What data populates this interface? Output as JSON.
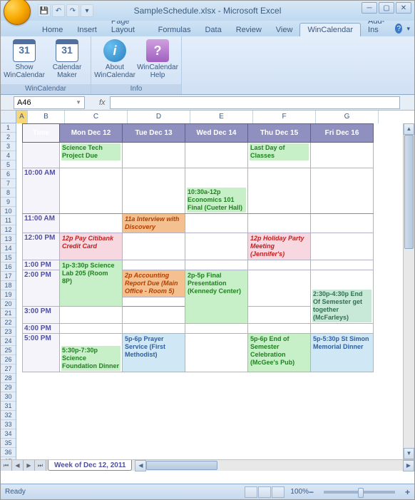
{
  "window": {
    "title": "SampleSchedule.xlsx - Microsoft Excel",
    "name_box": "A46",
    "status": "Ready",
    "zoom": "100%",
    "sheet_tab": "Week of Dec 12, 2011"
  },
  "tabs": {
    "home": "Home",
    "insert": "Insert",
    "page_layout": "Page Layout",
    "formulas": "Formulas",
    "data": "Data",
    "review": "Review",
    "view": "View",
    "wincalendar": "WinCalendar",
    "addins": "Add-Ins"
  },
  "ribbon": {
    "show": "Show\nWinCalendar",
    "maker": "Calendar\nMaker",
    "about": "About\nWinCalendar",
    "help": "WinCalendar\nHelp",
    "group1": "WinCalendar",
    "group2": "Info"
  },
  "cols": {
    "a": "A",
    "b": "B",
    "c": "C",
    "d": "D",
    "e": "E",
    "f": "F",
    "g": "G"
  },
  "headers": {
    "time": "Time",
    "mon": "Mon Dec 12",
    "tue": "Tue Dec 13",
    "wed": "Wed Dec 14",
    "thu": "Thu Dec 15",
    "fri": "Fri Dec 16"
  },
  "times": {
    "t10": "10:00 AM",
    "t11": "11:00 AM",
    "t12": "12:00 PM",
    "t1": "1:00 PM",
    "t2": "2:00 PM",
    "t3": "3:00 PM",
    "t4": "4:00 PM",
    "t5": "5:00 PM"
  },
  "events": {
    "sci_proj": "Science Tech Project Due",
    "last_day": "Last Day of Classes",
    "econ": "10:30a-12p Economics 101 Final (Cueter Hall)",
    "interview": "11a Interview with Discovery",
    "citibank": "12p Pay Citibank Credit Card",
    "holiday": "12p Holiday Party Meeting (Jennifer's)",
    "scilab": "1p-3:30p Science Lab 205 (Room 8P)",
    "accounting": "2p Accounting Report Due (Main Office - Room 5)",
    "kennedy": "2p-5p Final Presentation (Kennedy Center)",
    "mcfarleys": "2:30p-4:30p End Of Semester get together (McFarleys)",
    "prayer": "5p-6p Prayer Service (First Methodist)",
    "mcgee": "5p-6p End of Semester Celebration (McGee's Pub)",
    "stsimon": "5p-5:30p St Simon Memorial Dinner",
    "foundation": "5:30p-7:30p Science Foundation Dinner"
  }
}
